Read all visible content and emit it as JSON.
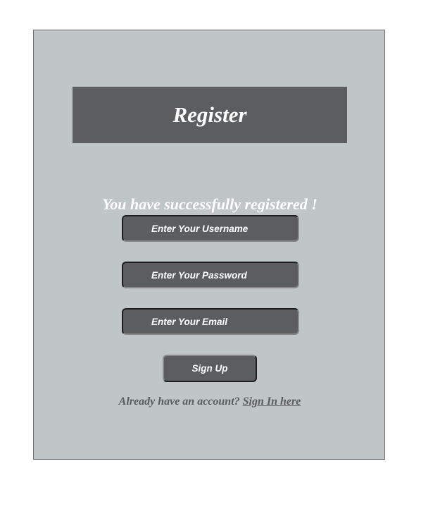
{
  "header": {
    "title": "Register"
  },
  "status": {
    "message": "You have successfully registered !"
  },
  "form": {
    "username_placeholder": "Enter Your Username",
    "password_placeholder": "Enter Your Password",
    "email_placeholder": "Enter Your Email",
    "signup_label": "Sign Up"
  },
  "footer": {
    "prompt": "Already have an account?",
    "link_label": "Sign In here"
  },
  "colors": {
    "panel_bg": "#c0c5c8",
    "dark_gray": "#5c5d5f",
    "text_light": "#ffffff",
    "text_muted": "#5a5c5e"
  }
}
